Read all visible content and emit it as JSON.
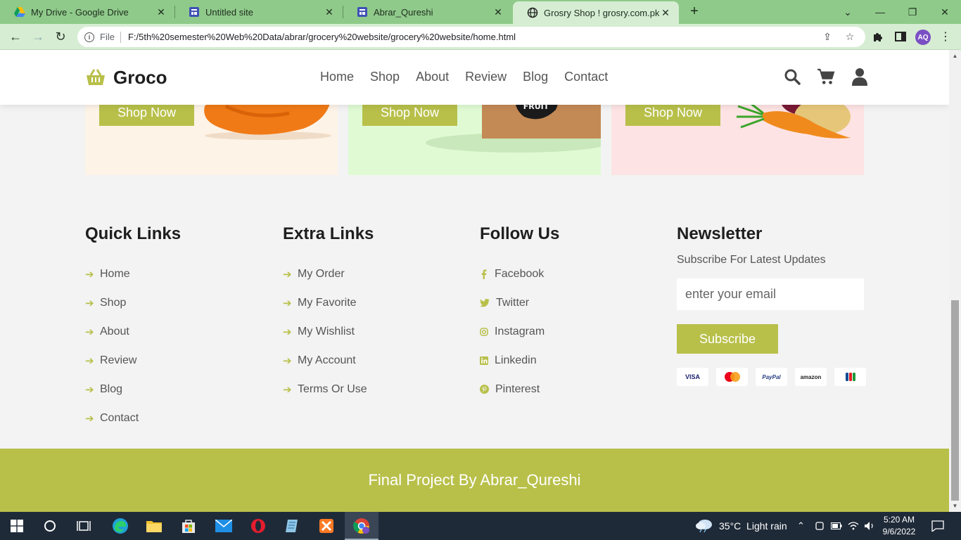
{
  "browser": {
    "tabs": [
      {
        "title": "My Drive - Google Drive",
        "icon": "google-drive-icon",
        "active": false
      },
      {
        "title": "Untitled site",
        "icon": "google-sites-icon",
        "active": false
      },
      {
        "title": "Abrar_Qureshi",
        "icon": "google-sites-icon",
        "active": false
      },
      {
        "title": "Grosry Shop ! grosry.com.pk",
        "icon": "globe-icon",
        "active": true
      }
    ],
    "address": {
      "scheme_label": "File",
      "url": "F:/5th%20semester%20Web%20Data/abrar/grocery%20website/grocery%20website/home.html"
    },
    "profile_initials": "AQ"
  },
  "site": {
    "logo": "Groco",
    "nav": [
      "Home",
      "Shop",
      "About",
      "Review",
      "Blog",
      "Contact"
    ],
    "cards": [
      {
        "button": "Shop Now",
        "bg": "#fdf3e7",
        "image": "bell-pepper-image"
      },
      {
        "button": "Shop Now",
        "bg": "#e0fbd4",
        "image": "smooth-fruit-box-image"
      },
      {
        "button": "Shop Now",
        "bg": "#fde3e3",
        "image": "carrot-potato-image"
      }
    ],
    "footer": {
      "quick_links": {
        "title": "Quick Links",
        "items": [
          "Home",
          "Shop",
          "About",
          "Review",
          "Blog",
          "Contact"
        ]
      },
      "extra_links": {
        "title": "Extra Links",
        "items": [
          "My Order",
          "My Favorite",
          "My Wishlist",
          "My Account",
          "Terms Or Use"
        ]
      },
      "follow_us": {
        "title": "Follow Us",
        "items": [
          {
            "label": "Facebook",
            "icon": "facebook-icon"
          },
          {
            "label": "Twitter",
            "icon": "twitter-icon"
          },
          {
            "label": "Instagram",
            "icon": "instagram-icon"
          },
          {
            "label": "Linkedin",
            "icon": "linkedin-icon"
          },
          {
            "label": "Pinterest",
            "icon": "pinterest-icon"
          }
        ]
      },
      "newsletter": {
        "title": "Newsletter",
        "subtitle": "Subscribe For Latest Updates",
        "email_placeholder": "enter your email",
        "button": "Subscribe",
        "payment_methods": [
          "VISA",
          "mastercard",
          "PayPal",
          "amazon",
          "JCB"
        ]
      },
      "credit": "Final Project By Abrar_Qureshi"
    },
    "accent": "#b8c04a"
  },
  "taskbar": {
    "weather": "35°C  Light rain",
    "time": "5:20 AM",
    "date": "9/6/2022"
  }
}
